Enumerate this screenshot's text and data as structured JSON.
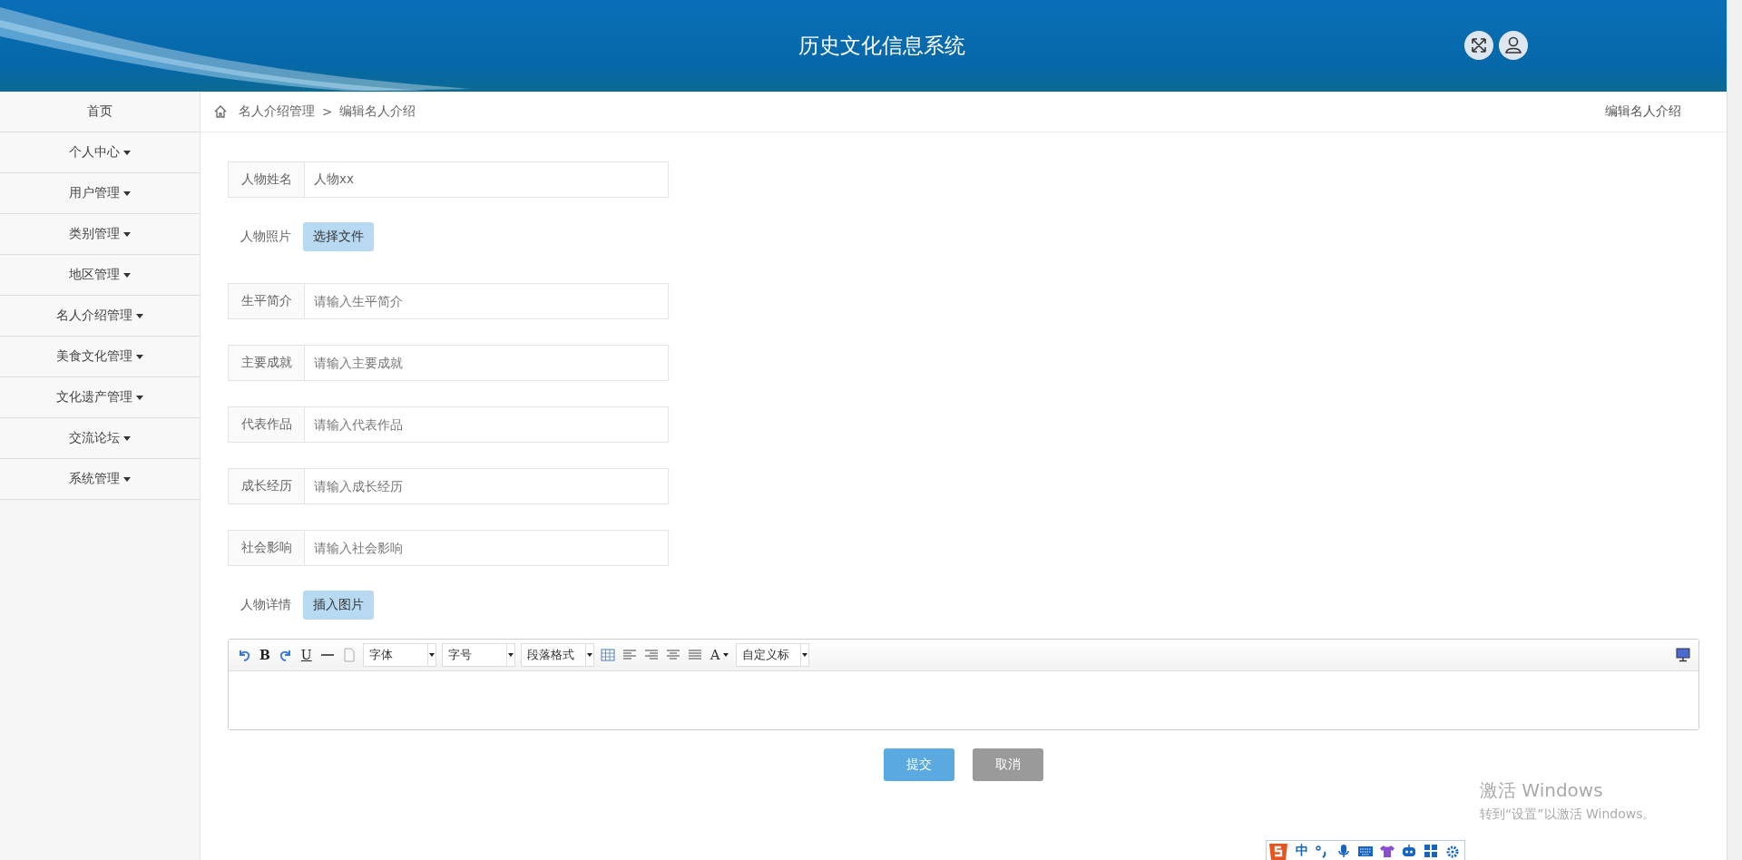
{
  "header": {
    "title": "历史文化信息系统",
    "actions": [
      {
        "kind": "fullscreen"
      },
      {
        "kind": "user"
      }
    ]
  },
  "sidebar": {
    "items": [
      {
        "label": "首页",
        "expandable": false
      },
      {
        "label": "个人中心",
        "expandable": true
      },
      {
        "label": "用户管理",
        "expandable": true
      },
      {
        "label": "类别管理",
        "expandable": true
      },
      {
        "label": "地区管理",
        "expandable": true
      },
      {
        "label": "名人介绍管理",
        "expandable": true
      },
      {
        "label": "美食文化管理",
        "expandable": true
      },
      {
        "label": "文化遗产管理",
        "expandable": true
      },
      {
        "label": "交流论坛",
        "expandable": true
      },
      {
        "label": "系统管理",
        "expandable": true
      }
    ]
  },
  "breadcrumb": {
    "items": [
      "名人介绍管理",
      "编辑名人介绍"
    ],
    "separator": ">",
    "page_title": "编辑名人介绍"
  },
  "form": {
    "fields": [
      {
        "kind": "input",
        "label": "人物姓名",
        "value": "人物xx"
      },
      {
        "kind": "upload",
        "label": "人物照片",
        "button": "选择文件"
      },
      {
        "kind": "input",
        "label": "生平简介",
        "placeholder": "请输入生平简介"
      },
      {
        "kind": "input",
        "label": "主要成就",
        "placeholder": "请输入主要成就"
      },
      {
        "kind": "input",
        "label": "代表作品",
        "placeholder": "请输入代表作品"
      },
      {
        "kind": "input",
        "label": "成长经历",
        "placeholder": "请输入成长经历"
      },
      {
        "kind": "input",
        "label": "社会影响",
        "placeholder": "请输入社会影响"
      },
      {
        "kind": "upload",
        "label": "人物详情",
        "button": "插入图片"
      }
    ],
    "editor": {
      "toolbar": [
        {
          "kind": "undo"
        },
        {
          "kind": "bold",
          "text": "B"
        },
        {
          "kind": "redo"
        },
        {
          "kind": "underline",
          "text": "U"
        },
        {
          "kind": "rule"
        },
        {
          "kind": "page"
        },
        {
          "kind": "select",
          "text": "字体"
        },
        {
          "kind": "select",
          "text": "字号"
        },
        {
          "kind": "select",
          "text": "段落格式"
        },
        {
          "kind": "table"
        },
        {
          "kind": "align-left"
        },
        {
          "kind": "align-right"
        },
        {
          "kind": "align-center"
        },
        {
          "kind": "justify"
        },
        {
          "kind": "color",
          "text": "A"
        },
        {
          "kind": "select",
          "text": "自定义标"
        }
      ],
      "right_tool": {
        "kind": "monitor"
      }
    },
    "buttons": [
      {
        "label": "提交",
        "kind": "primary"
      },
      {
        "label": "取消",
        "kind": "secondary"
      }
    ]
  },
  "os_overlay": {
    "activation_title": "激活 Windows",
    "activation_text": "转到“设置”以激活 Windows。",
    "ime": {
      "mode": "中"
    }
  }
}
